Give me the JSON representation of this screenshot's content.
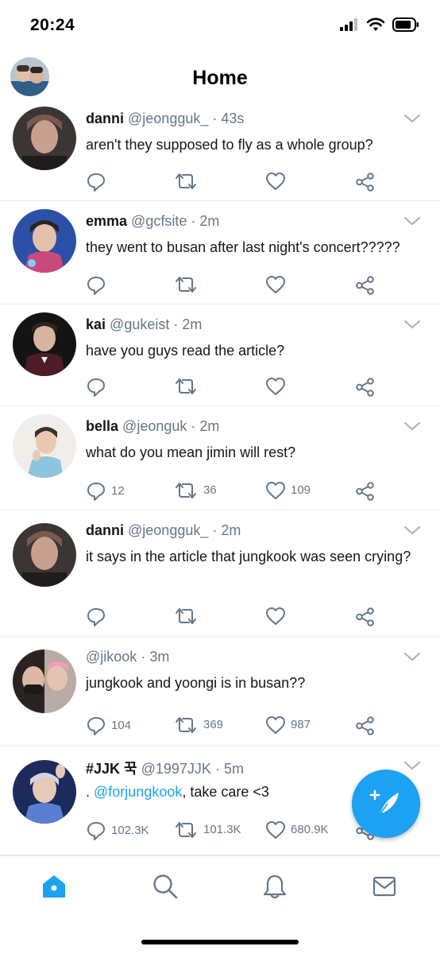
{
  "status_bar": {
    "time": "20:24",
    "icons": [
      "signal-icon",
      "wifi-icon",
      "battery-icon"
    ]
  },
  "header": {
    "title": "Home"
  },
  "tweets": [
    {
      "name": "danni",
      "handle": "@jeongguk_",
      "dot": "·",
      "time": "43s",
      "text": "aren't they supposed to fly as a whole group?",
      "replies": "",
      "retweets": "",
      "likes": ""
    },
    {
      "name": "emma",
      "handle": "@gcfsite",
      "dot": "·",
      "time": "2m",
      "text": "they went to busan after last night's concert?????",
      "replies": "",
      "retweets": "",
      "likes": ""
    },
    {
      "name": "kai",
      "handle": "@gukeist",
      "dot": "·",
      "time": "2m",
      "text": "have you guys read the article?",
      "replies": "",
      "retweets": "",
      "likes": ""
    },
    {
      "name": "bella",
      "handle": "@jeonguk",
      "dot": "·",
      "time": "2m",
      "text": "what do you mean jimin will rest?",
      "replies": "12",
      "retweets": "36",
      "likes": "109"
    },
    {
      "name": "danni",
      "handle": "@jeongguk_",
      "dot": "·",
      "time": "2m",
      "text": "it says in the article that jungkook was seen crying?",
      "replies": "",
      "retweets": "",
      "likes": ""
    },
    {
      "name": "",
      "handle": "@jikook",
      "dot": "·",
      "time": "3m",
      "text": "jungkook and yoongi is in busan??",
      "replies": "104",
      "retweets": "369",
      "likes": "987"
    },
    {
      "name": "#JJK 꾹",
      "handle": "@1997JJK",
      "dot": "·",
      "time": "5m",
      "text_prefix": ". ",
      "mention": "@forjungkook",
      "text_suffix": ", take care <3",
      "replies": "102.3K",
      "retweets": "101.3K",
      "likes": "680.9K"
    }
  ],
  "tabbar": {
    "tabs": [
      "home-icon",
      "search-icon",
      "notifications-icon",
      "messages-icon"
    ],
    "active": "home"
  },
  "colors": {
    "accent": "#1da1f2",
    "muted": "#657786",
    "text": "#14171a",
    "divider": "#e6ecf0"
  }
}
